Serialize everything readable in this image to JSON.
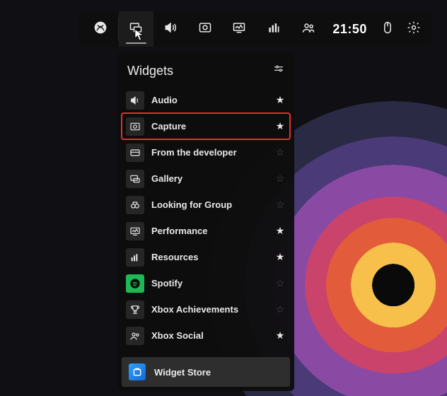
{
  "topbar": {
    "clock": "21:50"
  },
  "panel": {
    "title": "Widgets"
  },
  "widgets": [
    {
      "id": "audio",
      "label": "Audio",
      "icon": "speaker",
      "fav": true,
      "highlight": false
    },
    {
      "id": "capture",
      "label": "Capture",
      "icon": "camera",
      "fav": true,
      "highlight": true
    },
    {
      "id": "from-dev",
      "label": "From the developer",
      "icon": "card",
      "fav": false,
      "highlight": false
    },
    {
      "id": "gallery",
      "label": "Gallery",
      "icon": "gallery",
      "fav": false,
      "highlight": false
    },
    {
      "id": "lfg",
      "label": "Looking for Group",
      "icon": "binoculars",
      "fav": false,
      "highlight": false
    },
    {
      "id": "performance",
      "label": "Performance",
      "icon": "monitor",
      "fav": true,
      "highlight": false
    },
    {
      "id": "resources",
      "label": "Resources",
      "icon": "bars",
      "fav": true,
      "highlight": false
    },
    {
      "id": "spotify",
      "label": "Spotify",
      "icon": "spotify",
      "fav": false,
      "highlight": false
    },
    {
      "id": "achievements",
      "label": "Xbox Achievements",
      "icon": "trophy",
      "fav": false,
      "highlight": false
    },
    {
      "id": "xbox-social",
      "label": "Xbox Social",
      "icon": "people",
      "fav": true,
      "highlight": false
    }
  ],
  "store": {
    "label": "Widget Store"
  }
}
